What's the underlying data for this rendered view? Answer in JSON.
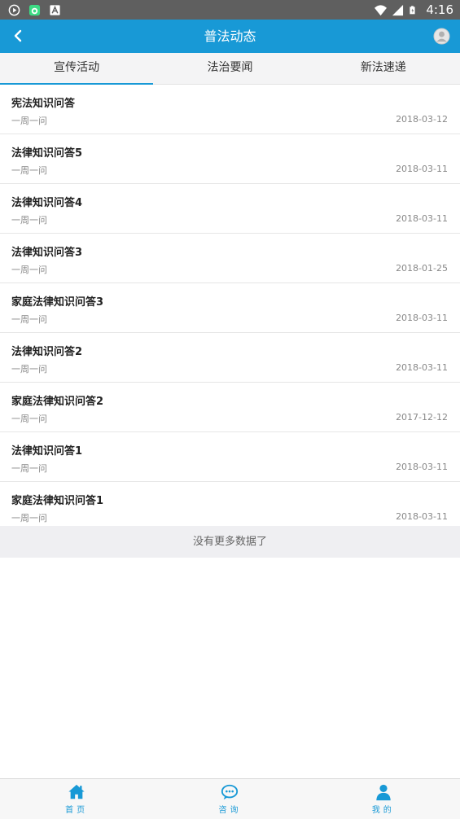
{
  "status_bar": {
    "time": "4:16",
    "icons": [
      "play-circle-icon",
      "android-icon",
      "a-icon",
      "wifi-icon",
      "signal-icon",
      "battery-icon"
    ]
  },
  "app_bar": {
    "title": "普法动态",
    "back_icon": "chevron-left-icon",
    "profile_icon": "user-avatar-icon",
    "color": "#1899d6"
  },
  "tabs": [
    {
      "label": "宣传活动",
      "active": true
    },
    {
      "label": "法治要闻",
      "active": false
    },
    {
      "label": "新法速递",
      "active": false
    }
  ],
  "list": [
    {
      "title": "宪法知识问答",
      "category": "一周一问",
      "date": "2018-03-12"
    },
    {
      "title": "法律知识问答5",
      "category": "一周一问",
      "date": "2018-03-11"
    },
    {
      "title": "法律知识问答4",
      "category": "一周一问",
      "date": "2018-03-11"
    },
    {
      "title": "法律知识问答3",
      "category": "一周一问",
      "date": "2018-01-25"
    },
    {
      "title": "家庭法律知识问答3",
      "category": "一周一问",
      "date": "2018-03-11"
    },
    {
      "title": "法律知识问答2",
      "category": "一周一问",
      "date": "2018-03-11"
    },
    {
      "title": "家庭法律知识问答2",
      "category": "一周一问",
      "date": "2017-12-12"
    },
    {
      "title": "法律知识问答1",
      "category": "一周一问",
      "date": "2018-03-11"
    },
    {
      "title": "家庭法律知识问答1",
      "category": "一周一问",
      "date": "2018-03-11"
    }
  ],
  "no_more_text": "没有更多数据了",
  "bottom_nav": [
    {
      "label": "首页",
      "icon": "home-icon"
    },
    {
      "label": "咨询",
      "icon": "chat-bubble-icon"
    },
    {
      "label": "我的",
      "icon": "user-icon"
    }
  ]
}
